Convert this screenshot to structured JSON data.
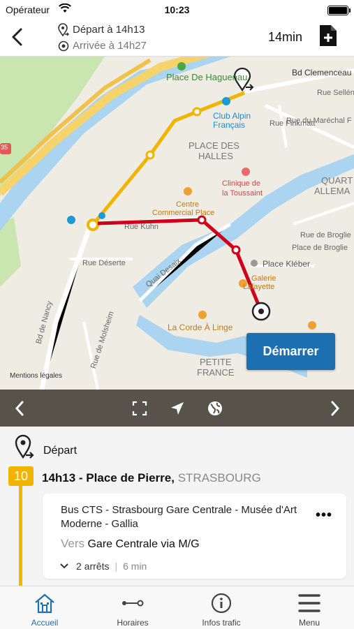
{
  "status": {
    "carrier": "Opérateur",
    "time": "10:23"
  },
  "header": {
    "departure": "Départ à 14h13",
    "arrival": "Arrivée à 14h27",
    "duration": "14min"
  },
  "map": {
    "labels": [
      "Place De Haguenau",
      "Bd Clemenceau",
      "Rue Sellénick",
      "Club Alpin",
      "Français",
      "Rue Finkmatt",
      "Rue du Maréchal F",
      "PLACE DES",
      "HALLES",
      "Clinique de",
      "la Toussaint",
      "QUART",
      "ALLEMA",
      "Centre",
      "Commercial Place",
      "Rue Kuhn",
      "Rue de Broglie",
      "Place de Broglie",
      "Quai Desaix",
      "Rue Déserte",
      "Place Kléber",
      "Galerie",
      "Lafayette",
      "La Corde À Linge",
      "Bd de Nancy",
      "Rue de Molsheim",
      "PETITE",
      "FRANCE",
      "35"
    ],
    "start_button": "Démarrer",
    "legal": "Mentions légales"
  },
  "itinerary": {
    "departure_label": "Départ",
    "line_number": "10",
    "stop_time": "14h13 - Place de Pierre,",
    "stop_city": "STRASBOURG",
    "route_title": "Bus CTS - Strasbourg Gare Centrale - Musée d'Art Moderne - Gallia",
    "direction_word": "Vers",
    "direction": "Gare Centrale via M/G",
    "stops": "2 arrêts",
    "stops_duration": "6 min"
  },
  "tabs": [
    {
      "label": "Accueil",
      "icon": "home-icon"
    },
    {
      "label": "Horaires",
      "icon": "line-stop-icon"
    },
    {
      "label": "Infos trafic",
      "icon": "info-icon"
    },
    {
      "label": "Menu",
      "icon": "hamburger-icon"
    }
  ],
  "colors": {
    "accent": "#1c6fb0",
    "bus_line": "#f1b400",
    "route_red": "#d0021b"
  }
}
